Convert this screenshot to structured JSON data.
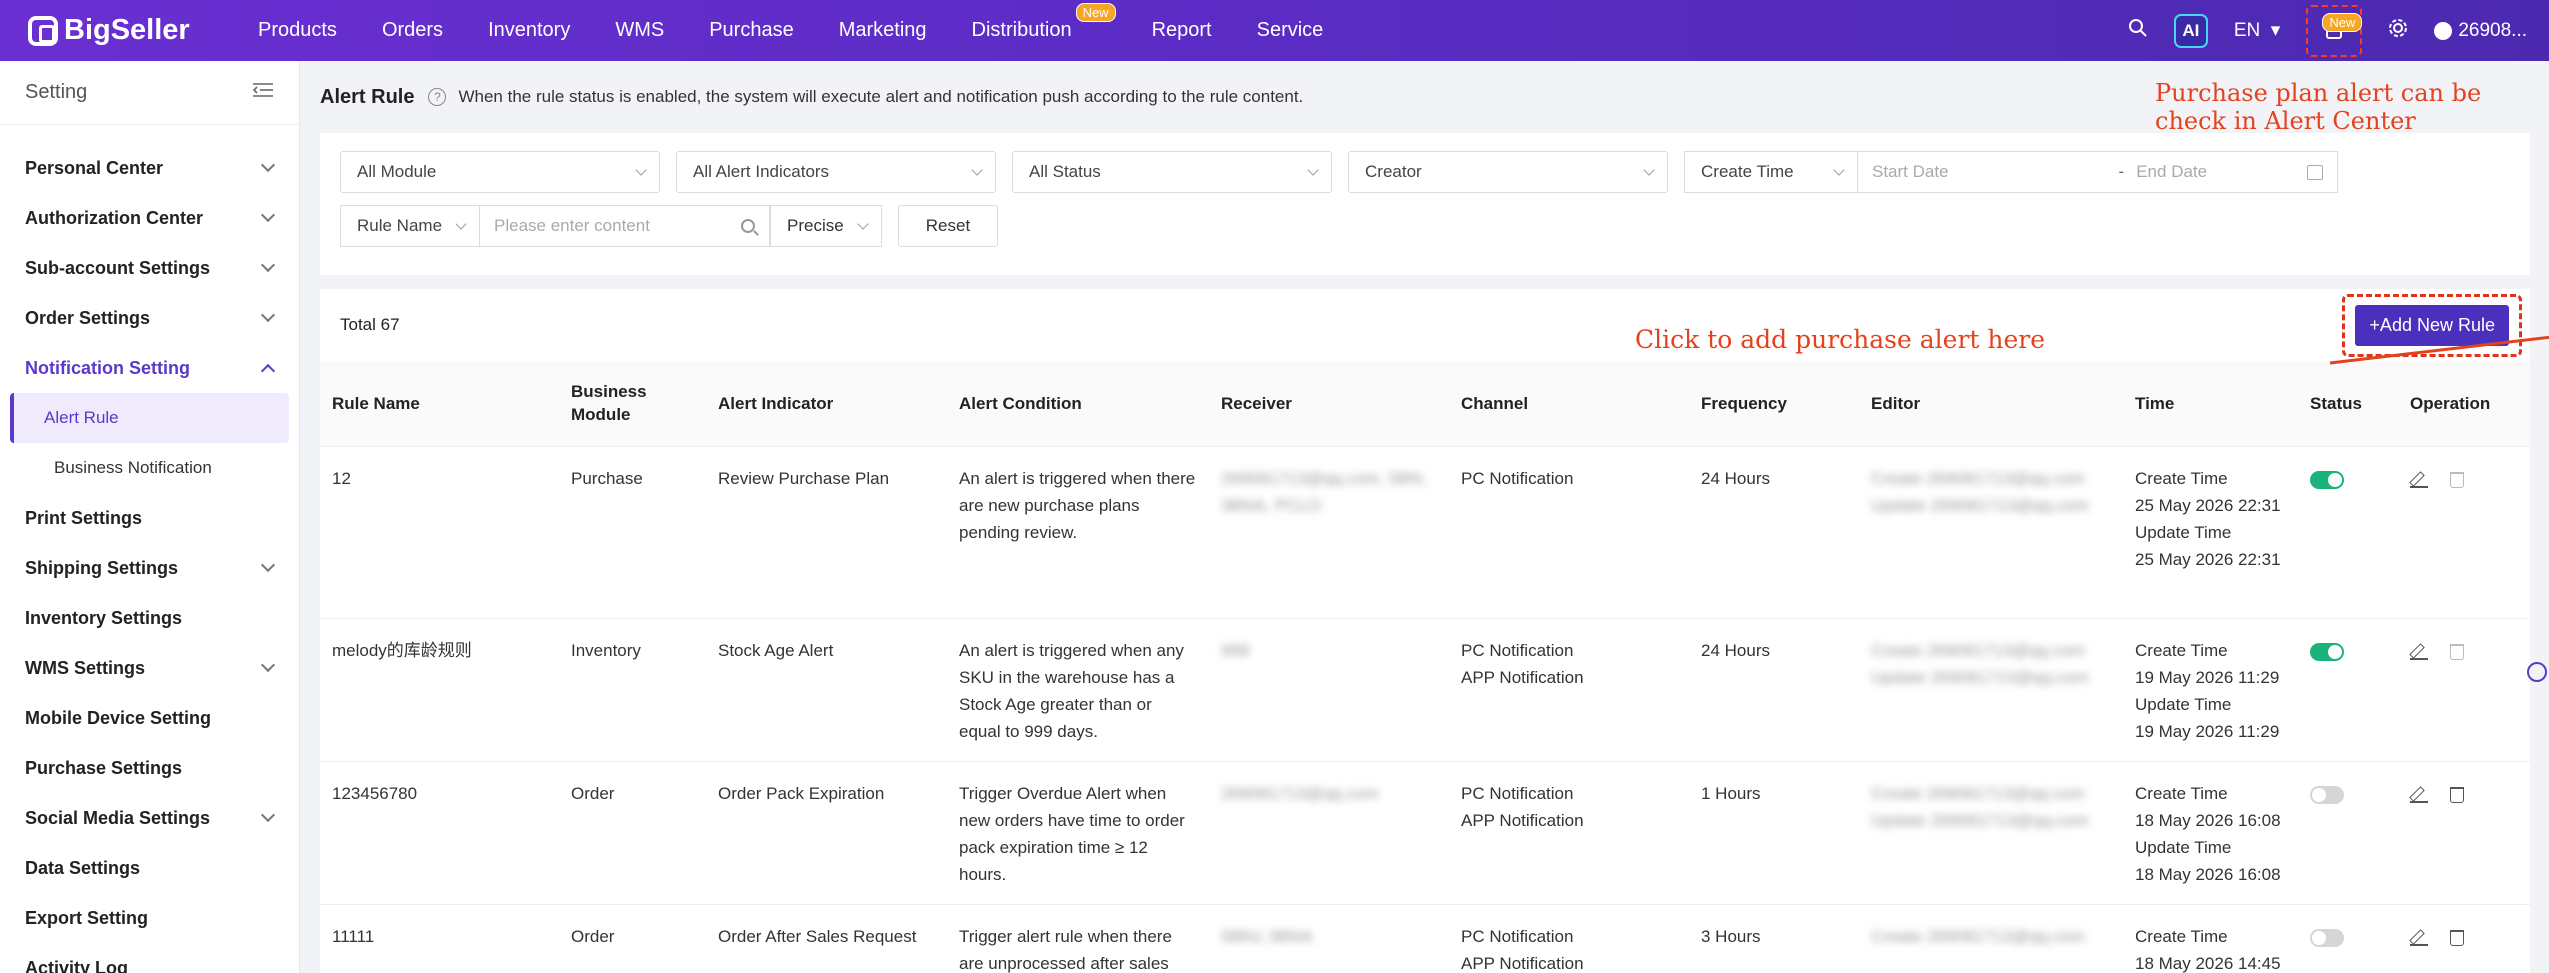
{
  "brand": "BigSeller",
  "nav": [
    "Products",
    "Orders",
    "Inventory",
    "WMS",
    "Purchase",
    "Marketing",
    "Distribution",
    "Report",
    "Service"
  ],
  "nav_new_badge": "New",
  "topbar": {
    "ai": "AI",
    "lang": "EN",
    "user": "26908...",
    "bell_badge": "New"
  },
  "sidebar": {
    "title": "Setting",
    "items": [
      {
        "label": "Personal Center"
      },
      {
        "label": "Authorization Center"
      },
      {
        "label": "Sub-account Settings"
      },
      {
        "label": "Order Settings"
      },
      {
        "label": "Notification Setting"
      },
      {
        "label": "Print Settings"
      },
      {
        "label": "Shipping Settings"
      },
      {
        "label": "Inventory Settings"
      },
      {
        "label": "WMS Settings"
      },
      {
        "label": "Mobile Device Setting"
      },
      {
        "label": "Purchase Settings"
      },
      {
        "label": "Social Media Settings"
      },
      {
        "label": "Data Settings"
      },
      {
        "label": "Export Setting"
      },
      {
        "label": "Activity Log"
      }
    ],
    "sub": [
      "Alert Rule",
      "Business Notification"
    ]
  },
  "page": {
    "title": "Alert Rule",
    "desc": "When the rule status is enabled, the system will execute alert and notification push according to the rule content."
  },
  "annotations": {
    "top": "Purchase plan alert can be check in Alert Center",
    "mid": "Click to add purchase alert here"
  },
  "filters": {
    "module": "All Module",
    "indicators": "All Alert Indicators",
    "status": "All Status",
    "creator": "Creator",
    "create_time": "Create Time",
    "start_date": "Start Date",
    "date_sep": "-",
    "end_date": "End Date",
    "rule_name": "Rule Name",
    "search_placeholder": "Please enter content",
    "precise": "Precise",
    "reset": "Reset"
  },
  "table": {
    "total": "Total 67",
    "add_button": "+Add New Rule",
    "headers": [
      "Rule Name",
      "Business Module",
      "Alert Indicator",
      "Alert Condition",
      "Receiver",
      "Channel",
      "Frequency",
      "Editor",
      "Time",
      "Status",
      "Operation"
    ],
    "rows": [
      {
        "name": "12",
        "module": "Purchase",
        "indicator": "Review Purchase Plan",
        "condition": "An alert is triggered when there are new purchase plans pending review.",
        "receiver": "269081713@qq.com, 5BN, 3BNA, PCLO",
        "channel": [
          "PC Notification"
        ],
        "frequency": "24 Hours",
        "editor": "Create 269081713@qq.com Update 269081713@qq.com",
        "time": [
          "Create Time",
          "25 May 2026 22:31",
          "Update Time",
          "25 May 2026 22:31"
        ],
        "enabled": true
      },
      {
        "name": "melody的库龄规则",
        "module": "Inventory",
        "indicator": "Stock Age Alert",
        "condition": "An alert is triggered when any SKU in the warehouse has a Stock Age greater than or equal to 999 days.",
        "receiver": "999",
        "channel": [
          "PC Notification",
          "APP Notification"
        ],
        "frequency": "24 Hours",
        "editor": "Create 269081713@qq.com Update 269081713@qq.com",
        "time": [
          "Create Time",
          "19 May 2026 11:29",
          "Update Time",
          "19 May 2026 11:29"
        ],
        "enabled": true
      },
      {
        "name": "123456780",
        "module": "Order",
        "indicator": "Order Pack Expiration",
        "condition": "Trigger Overdue Alert when new orders have time to order pack expiration time ≥ 12 hours.",
        "receiver": "269081713@qq.com",
        "channel": [
          "PC Notification",
          "APP Notification"
        ],
        "frequency": "1 Hours",
        "editor": "Create 269081713@qq.com Update 269081713@qq.com",
        "time": [
          "Create Time",
          "18 May 2026 16:08",
          "Update Time",
          "18 May 2026 16:08"
        ],
        "enabled": false
      },
      {
        "name": "11111",
        "module": "Order",
        "indicator": "Order After Sales Request",
        "condition": "Trigger alert rule when there are unprocessed after sales",
        "receiver": "5BN1 3BNA",
        "channel": [
          "PC Notification",
          "APP Notification"
        ],
        "frequency": "3 Hours",
        "editor": "Create 269081713@qq.com",
        "time": [
          "Create Time",
          "18 May 2026 14:45"
        ],
        "enabled": false
      }
    ]
  },
  "colors": {
    "accent": "#5b39c9",
    "annotation": "#e4421d",
    "toggle_on": "#1ab37a"
  }
}
